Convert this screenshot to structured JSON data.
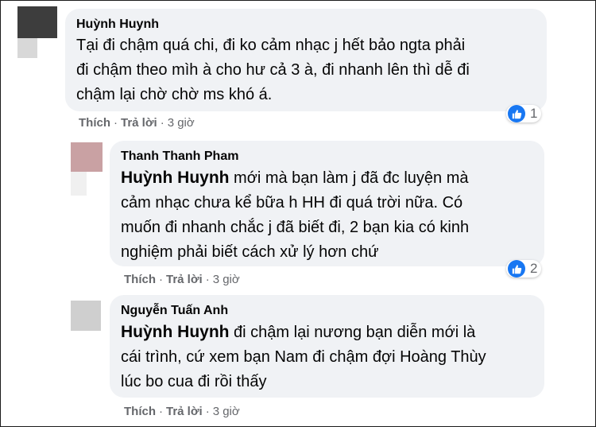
{
  "comments": [
    {
      "author": "Huỳnh Huynh",
      "mention": "",
      "text": "Tại đi chậm quá chi, đi ko cảm nhạc j hết bảo ngta phải\nđi chậm theo mìh à cho hư cả 3 à, đi nhanh lên thì dễ đi\nchậm lại chờ chờ ms khó á.",
      "reaction_count": "1",
      "like_label": "Thích",
      "reply_label": "Trả lời",
      "separator": "·",
      "time": "3 giờ",
      "avatar_colors": [
        "#3d3d3d",
        "#d3d3d3"
      ]
    },
    {
      "author": "Thanh Thanh Pham",
      "mention": "Huỳnh Huynh",
      "text": " mới mà bạn làm j đã đc luyện mà\ncảm nhạc chưa kể bữa h HH đi quá trời nữa. Có\nmuốn đi nhanh chắc j đã biết đi, 2 bạn kia có kinh\nnghiệm phải biết cách xử lý hơn chứ",
      "reaction_count": "2",
      "like_label": "Thích",
      "reply_label": "Trả lời",
      "separator": "·",
      "time": "3 giờ",
      "avatar_colors": [
        "#c9a1a3",
        "#efefef"
      ]
    },
    {
      "author": "Nguyễn Tuấn Anh",
      "mention": "Huỳnh Huynh",
      "text": " đi chậm lại nương bạn diễn mới là\ncái trình, cứ xem bạn Nam đi chậm đợi Hoàng Thùy\nlúc bo cua đi rồi thấy",
      "reaction_count": "",
      "like_label": "Thích",
      "reply_label": "Trả lời",
      "separator": "·",
      "time": "3 giờ",
      "avatar_colors": [
        "#cfcfcf"
      ]
    }
  ],
  "icons": {
    "reaction": "like-thumb-icon"
  },
  "colors": {
    "bubble": "#f0f2f5",
    "like_blue": "#1877f2",
    "meta_text": "#65676b"
  }
}
